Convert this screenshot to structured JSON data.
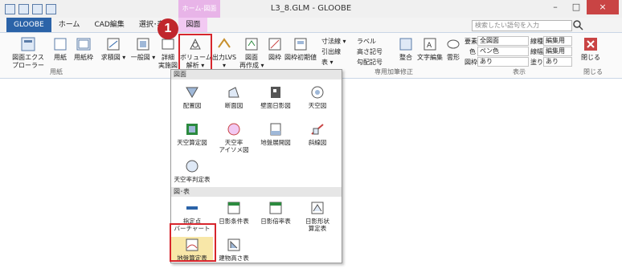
{
  "window": {
    "title": "L3_8.GLM - GLOOBE",
    "context_tab_header": "ホーム-図面",
    "minimize": "–",
    "maximize": "□",
    "close": "×"
  },
  "tabs": [
    {
      "label": "GLOOBE"
    },
    {
      "label": "ホーム"
    },
    {
      "label": "CAD編集"
    },
    {
      "label": "選択･表示"
    },
    {
      "label": "図面"
    }
  ],
  "search": {
    "placeholder": "検索したい語句を入力"
  },
  "ribbon": {
    "buttons": [
      {
        "label": "図面エクス\nプローラー"
      },
      {
        "label": "用紙"
      },
      {
        "label": "用紙枠"
      },
      {
        "label": "求積図 ▾"
      },
      {
        "label": "一般図 ▾"
      },
      {
        "label": "詳細\n実施図"
      },
      {
        "label": "ボリューム\n解析 ▾"
      },
      {
        "label": "出力LVS ▾"
      },
      {
        "label": "図面\n再作成 ▾"
      },
      {
        "label": "図枠"
      },
      {
        "label": "図枠初期値"
      },
      {
        "label": "整合"
      },
      {
        "label": "文字編集"
      },
      {
        "label": "雲形"
      },
      {
        "label": "閉じる"
      }
    ],
    "small": {
      "dim": "寸法線 ▾",
      "label": "ラベル",
      "leader": "引出線",
      "height_mark": "高さ記号",
      "table": "表 ▾",
      "slope_mark": "勾配記号"
    },
    "props": {
      "element_label": "要素",
      "element_value": "全図面",
      "color_label": "色",
      "color_value": "ペン色",
      "frame_label": "図枠",
      "frame_value": "あり",
      "line_type": "線種",
      "line_type_value": "編集用",
      "line_width": "線幅",
      "line_width_value": "編集用",
      "fill": "塗り",
      "fill_value": "あり"
    },
    "groups": {
      "paper": "用紙",
      "annotation": "専用加筆修正",
      "display": "表示",
      "close": "閉じる"
    }
  },
  "callout": "1",
  "dropdown": {
    "section1": "図面",
    "items1": [
      {
        "label": "配置図"
      },
      {
        "label": "断面図"
      },
      {
        "label": "壁面日影図"
      },
      {
        "label": "天空図"
      },
      {
        "label": "天空算定図"
      },
      {
        "label": "天空率\nアイソメ図"
      },
      {
        "label": "地盤展開図"
      },
      {
        "label": "斜線図"
      },
      {
        "label": "天空率判定表"
      }
    ],
    "section2": "図･表",
    "items2": [
      {
        "label": "指定点\nバーチャート"
      },
      {
        "label": "日影条件表"
      },
      {
        "label": "日影倍率表"
      },
      {
        "label": "日影形状\n算定表"
      },
      {
        "label": "地盤算定表"
      },
      {
        "label": "建物高さ表"
      }
    ]
  },
  "colors": {
    "accent": "#2b63a8",
    "highlight": "#d7262d",
    "context": "#f2c9f2"
  }
}
